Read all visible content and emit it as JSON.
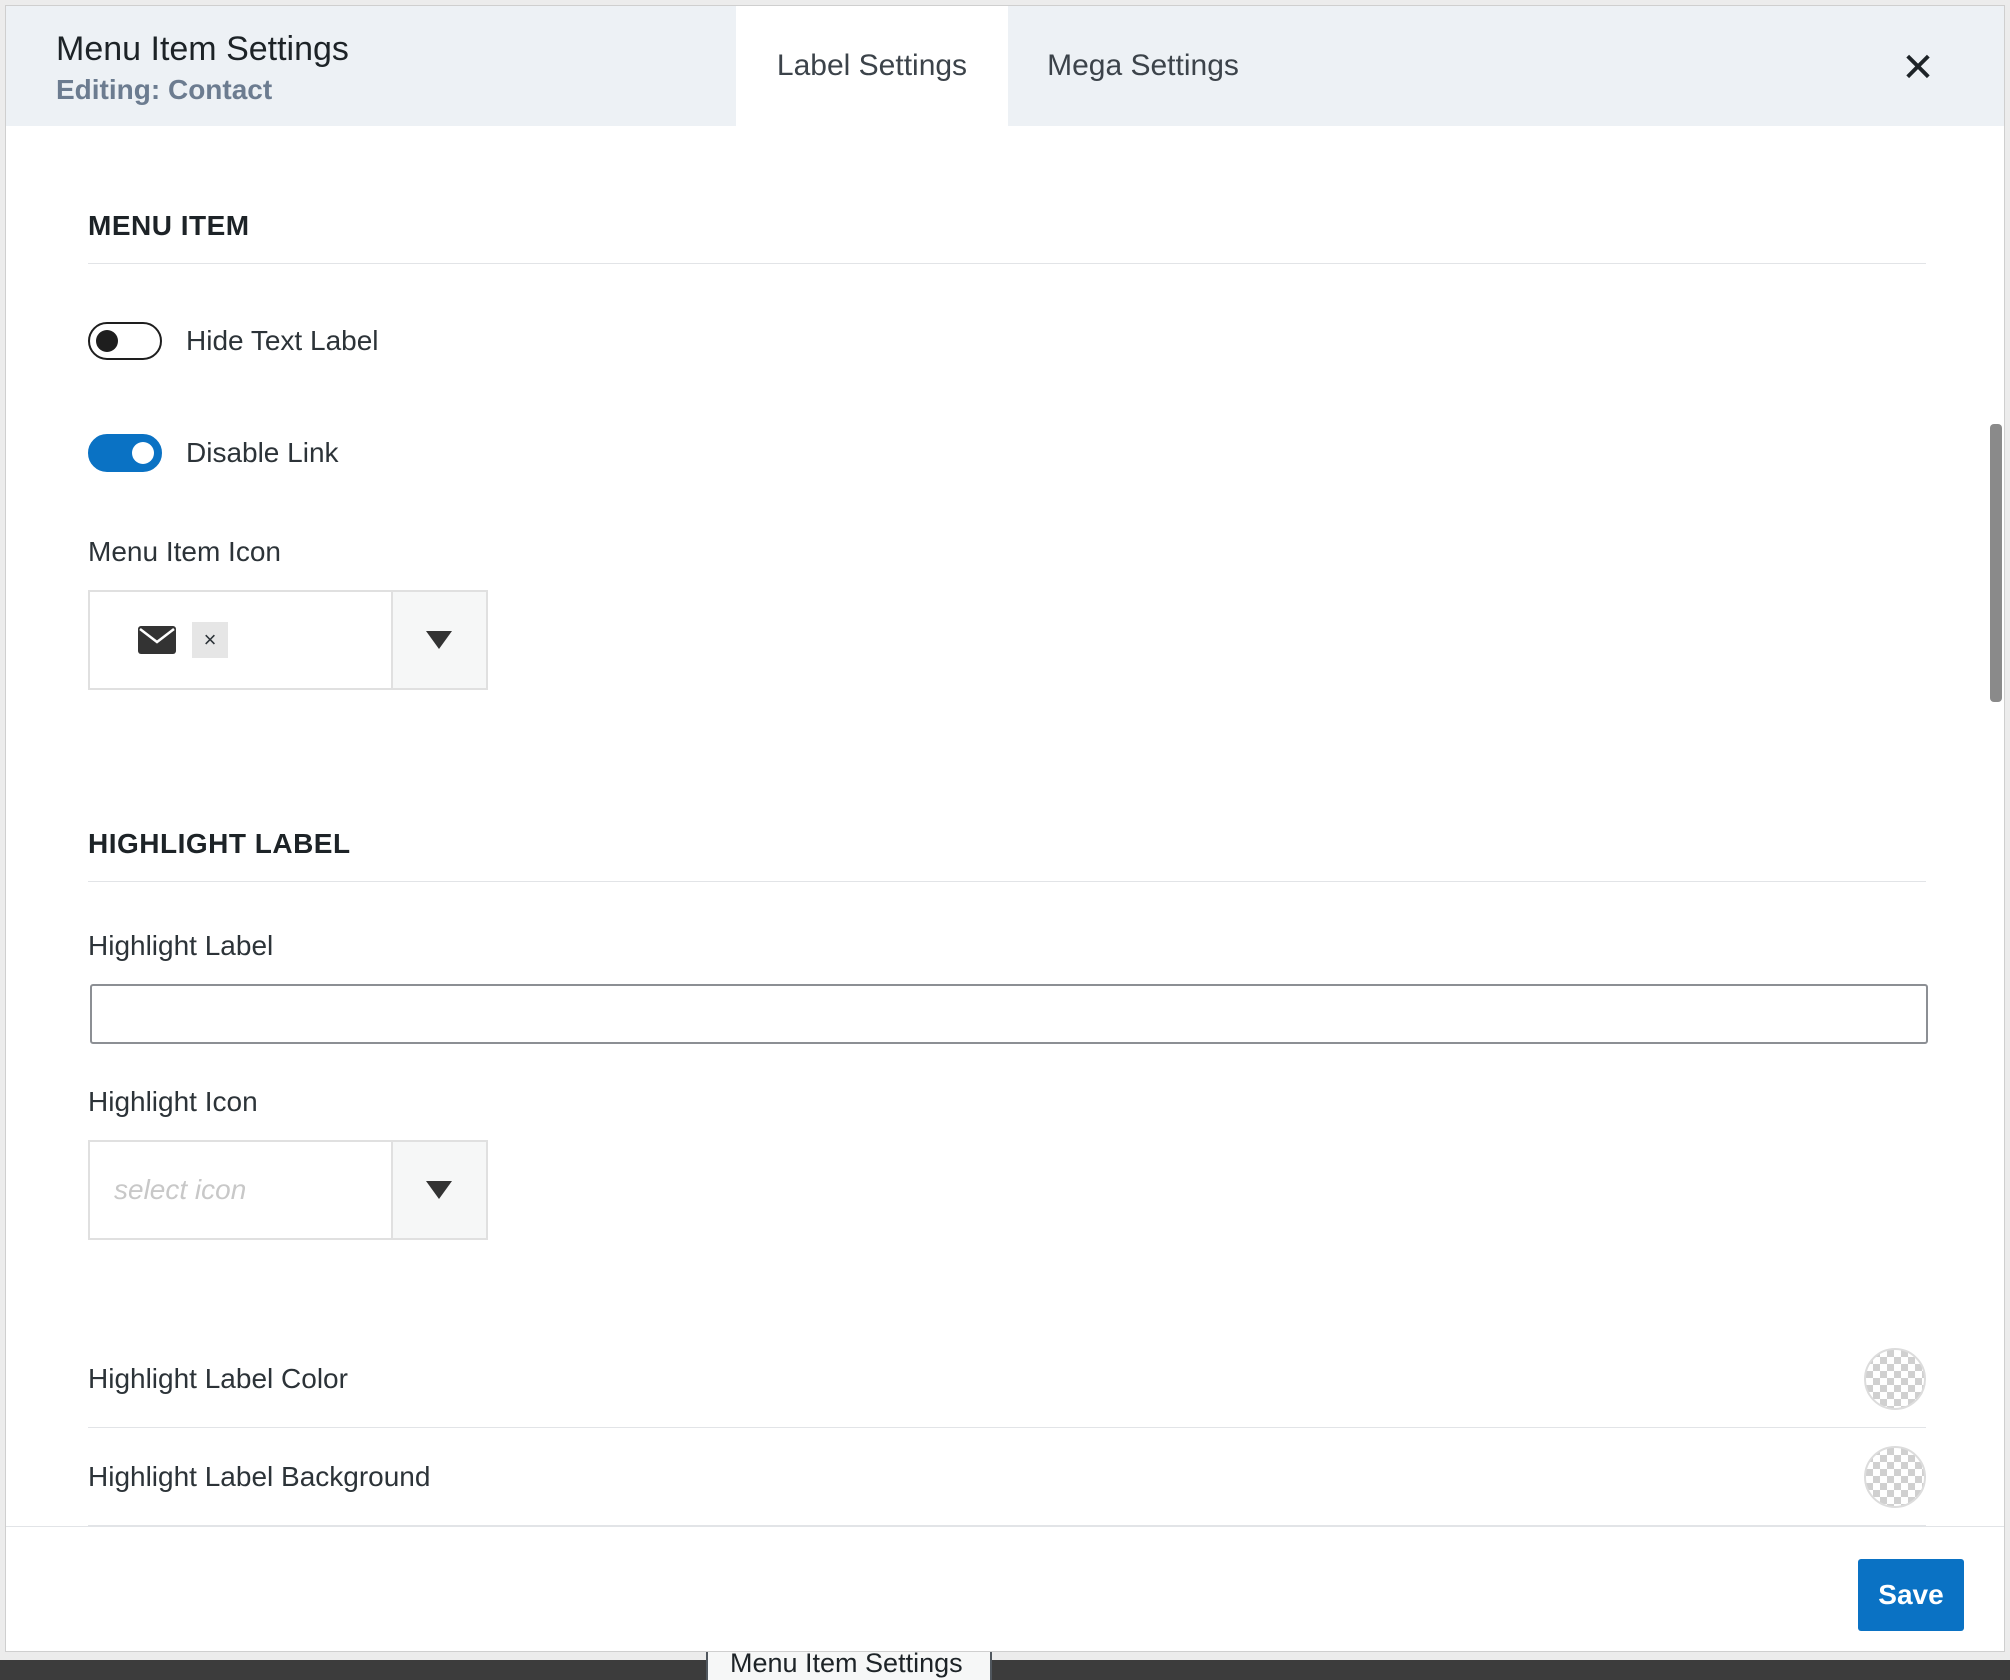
{
  "header": {
    "title": "Menu Item Settings",
    "subtitle": "Editing: Contact",
    "tabs": [
      {
        "label": "Label Settings",
        "active": true
      },
      {
        "label": "Mega Settings",
        "active": false
      }
    ],
    "close_icon": "close-icon"
  },
  "menu_item_section": {
    "title": "MENU ITEM",
    "hide_text_label": {
      "label": "Hide Text Label",
      "enabled": false
    },
    "disable_link": {
      "label": "Disable Link",
      "enabled": true
    },
    "icon_field": {
      "label": "Menu Item Icon",
      "selected_icon": "envelope-icon",
      "remove_label": "×"
    }
  },
  "highlight_section": {
    "title": "HIGHLIGHT LABEL",
    "highlight_label": {
      "label": "Highlight Label",
      "value": ""
    },
    "highlight_icon": {
      "label": "Highlight Icon",
      "placeholder": "select icon"
    },
    "label_color": {
      "label": "Highlight Label Color"
    },
    "label_background": {
      "label": "Highlight Label Background"
    }
  },
  "footer": {
    "save_label": "Save"
  },
  "background": {
    "tab_label": "Menu Item Settings"
  },
  "colors": {
    "accent": "#0a72c4",
    "header_bg": "#edf1f5"
  }
}
